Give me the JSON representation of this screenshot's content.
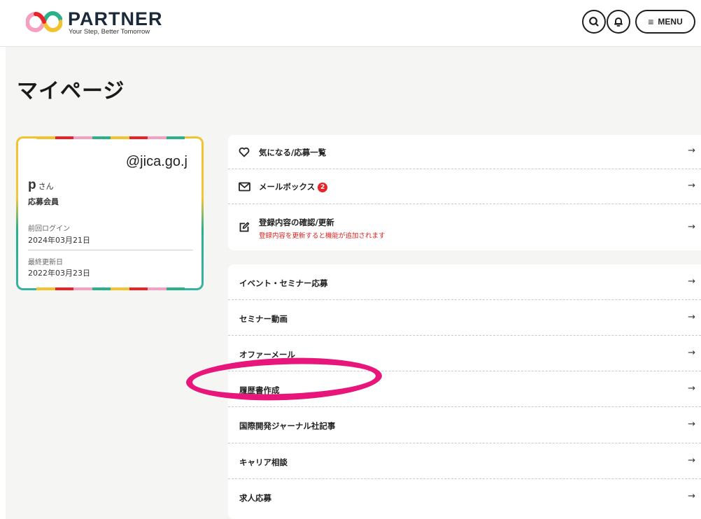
{
  "header": {
    "logo_name": "PARTNER",
    "logo_tagline": "Your Step, Better Tomorrow",
    "menu_label": "MENU",
    "search_icon": "search-icon",
    "bell_icon": "bell-icon"
  },
  "page": {
    "title": "マイページ"
  },
  "profile": {
    "email": "@jica.go.j",
    "name": "p",
    "name_suffix": "さん",
    "role": "応募会員",
    "last_login_label": "前回ログイン",
    "last_login_value": "2024年03月21日",
    "last_updated_label": "最終更新日",
    "last_updated_value": "2022年03月23日",
    "stripe_colors": [
      "#f2c230",
      "#e8242a",
      "#f5a0c0",
      "#2bb08a",
      "#f2c230",
      "#e8242a",
      "#f5a0c0",
      "#2bb08a"
    ]
  },
  "account_menu": [
    {
      "label": "気になる/応募一覧",
      "icon": "heart-icon"
    },
    {
      "label": "メールボックス",
      "icon": "mail-icon",
      "badge": "2"
    },
    {
      "label": "登録内容の確認/更新",
      "icon": "edit-icon",
      "note": "登録内容を更新すると機能が追加されます"
    }
  ],
  "service_menu": [
    {
      "label": "イベント・セミナー応募"
    },
    {
      "label": "セミナー動画"
    },
    {
      "label": "オファーメール"
    },
    {
      "label": "履歴書作成"
    },
    {
      "label": "国際開発ジャーナル社記事"
    },
    {
      "label": "キャリア相談"
    },
    {
      "label": "求人応募"
    }
  ],
  "arrow_glyph": "→",
  "colors": {
    "accent_red": "#e8242a",
    "highlight_pink": "#e8157a",
    "background": "#f5f5f3"
  }
}
